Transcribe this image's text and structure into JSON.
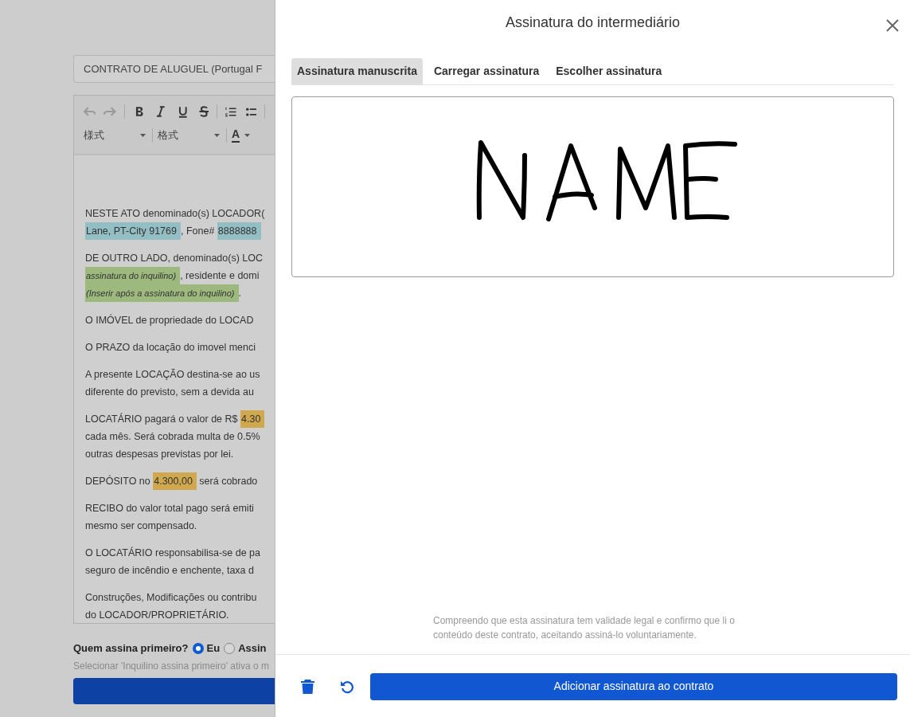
{
  "background": {
    "title_field": {
      "value": "CONTRATO DE ALUGUEL (Portugal F"
    },
    "toolbar": {
      "style_dropdown": "様式",
      "format_dropdown": "格式",
      "color_button": "A"
    },
    "paragraphs": [
      {
        "lines": [
          [
            {
              "kind": "text",
              "text": "NESTE ATO denominado(s) LOCADOR("
            }
          ],
          [
            {
              "kind": "field",
              "text": "Lane, PT-City 91769",
              "color": "#93bfc4",
              "italic": false
            },
            {
              "kind": "text",
              "text": ", Fone# "
            },
            {
              "kind": "field",
              "text": "8888888",
              "color": "#93bfc4",
              "italic": false
            }
          ]
        ]
      },
      {
        "lines": [
          [
            {
              "kind": "text",
              "text": "DE OUTRO LADO, denominado(s) LOC"
            }
          ],
          [
            {
              "kind": "field",
              "text": "assinatura do inquilino)",
              "color": "#9db97e",
              "italic": true
            },
            {
              "kind": "text",
              "text": ", residente e domi"
            }
          ],
          [
            {
              "kind": "field",
              "text": "(Inserir após a assinatura do inquilino)",
              "color": "#9db97e",
              "italic": true
            },
            {
              "kind": "text",
              "text": "."
            }
          ]
        ]
      },
      {
        "lines": [
          [
            {
              "kind": "text",
              "text": "O IMÓVEL de propriedade do LOCAD"
            }
          ]
        ]
      },
      {
        "lines": [
          [
            {
              "kind": "text",
              "text": "O PRAZO da locação do imovel menci"
            }
          ]
        ]
      },
      {
        "lines": [
          [
            {
              "kind": "text",
              "text": "A presente LOCAÇÃO destina-se ao us"
            }
          ],
          [
            {
              "kind": "text",
              "text": "diferente do previsto, sem a devida au"
            }
          ]
        ]
      },
      {
        "lines": [
          [
            {
              "kind": "text",
              "text": "LOCATÁRIO pagará o valor de R$ "
            },
            {
              "kind": "field",
              "text": "4.30",
              "color": "#d0a94f",
              "italic": false
            }
          ],
          [
            {
              "kind": "text",
              "text": "cada mês. Será cobrada multa de 0.5%"
            }
          ],
          [
            {
              "kind": "text",
              "text": "outras despesas previstas por lei."
            }
          ]
        ]
      },
      {
        "lines": [
          [
            {
              "kind": "text",
              "text": "DEPÓSITO no "
            },
            {
              "kind": "field",
              "text": "4.300,00",
              "color": "#d0a94f",
              "italic": false
            },
            {
              "kind": "text",
              "text": " será cobrado"
            }
          ]
        ]
      },
      {
        "lines": [
          [
            {
              "kind": "text",
              "text": "RECIBO do valor total pago será emiti"
            }
          ],
          [
            {
              "kind": "text",
              "text": "mesmo ser compensado."
            }
          ]
        ]
      },
      {
        "lines": [
          [
            {
              "kind": "text",
              "text": "O LOCATÁRIO responsabilisa-se de pa"
            }
          ],
          [
            {
              "kind": "text",
              "text": "seguro de incêndio e enchente, taxa d"
            }
          ]
        ]
      },
      {
        "lines": [
          [
            {
              "kind": "text",
              "text": "Construções, Modificações ou contribu"
            }
          ],
          [
            {
              "kind": "text",
              "text": "do LOCADOR/PROPRIETÁRIO."
            }
          ]
        ]
      }
    ],
    "signer_question": {
      "label": "Quem assina primeiro?",
      "options": [
        {
          "label": "Eu",
          "selected": true
        },
        {
          "label": "Assin",
          "selected": false
        }
      ],
      "hint": "Selecionar 'Inquilino assina primeiro' ativa o m"
    }
  },
  "dialog": {
    "title": "Assinatura do intermediário",
    "tabs": [
      {
        "label": "Assinatura manuscrita",
        "selected": true
      },
      {
        "label": "Carregar assinatura",
        "selected": false
      },
      {
        "label": "Escolher assinatura",
        "selected": false
      }
    ],
    "disclaimer": "Compreendo que esta assinatura tem validade legal e confirmo que li o conteúdo deste contrato, aceitando assiná-lo voluntariamente.",
    "submit_button": "Adicionar assinatura ao contrato"
  }
}
